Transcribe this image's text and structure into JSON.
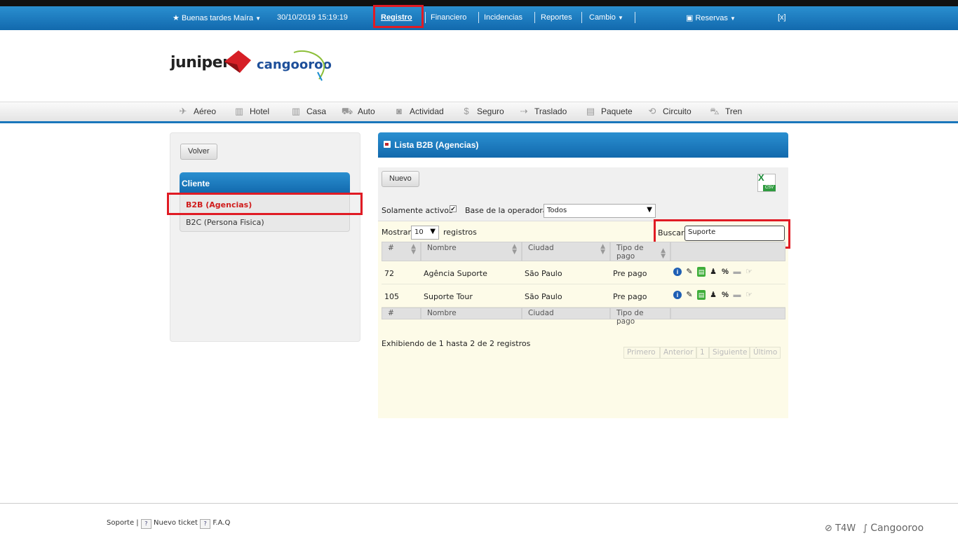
{
  "topbar": {
    "greeting": "Buenas tardes Maíra",
    "datetime": "30/10/2019 15:19:19",
    "menu": [
      "Registro",
      "Financiero",
      "Incidencias",
      "Reportes",
      "Cambio"
    ],
    "reservas": "Reservas",
    "close": "[x]"
  },
  "logos": {
    "juniper": "juniper",
    "cangooroo": "cangooroo"
  },
  "nav": [
    "Aéreo",
    "Hotel",
    "Casa",
    "Auto",
    "Actividad",
    "Seguro",
    "Traslado",
    "Paquete",
    "Circuito",
    "Tren"
  ],
  "left": {
    "back": "Volver",
    "section": "Cliente",
    "items": [
      "B2B (Agencias)",
      "B2C (Persona Fisica)"
    ]
  },
  "main": {
    "title": "Lista B2B (Agencias)",
    "new": "Nuevo",
    "csv": "CSV",
    "only_active": "Solamente activos",
    "base_label": "Base de la operadora",
    "base_value": "Todos",
    "show": "Mostrar",
    "show_value": "10",
    "records": "registros",
    "search_label": "Buscar",
    "search_value": "Suporte",
    "columns": [
      "#",
      "Nombre",
      "Ciudad",
      "Tipo de pago"
    ],
    "rows": [
      {
        "id": "72",
        "name": "Agência Suporte",
        "city": "São Paulo",
        "pay": "Pre pago"
      },
      {
        "id": "105",
        "name": "Suporte Tour",
        "city": "São Paulo",
        "pay": "Pre pago"
      }
    ],
    "info": "Exhibiendo de 1 hasta 2 de 2 registros",
    "pager": [
      "Primero",
      "Anterior",
      "1",
      "Siguiente",
      "Último"
    ]
  },
  "footer": {
    "support": "Soporte",
    "new_ticket": "Nuevo ticket",
    "faq": "F.A.Q",
    "brand1": "T4W",
    "brand2": "Cangooroo"
  },
  "colors": {
    "blue": "#1a76bb",
    "highlight": "#e01b24",
    "rowbg": "#fdfbe8"
  }
}
